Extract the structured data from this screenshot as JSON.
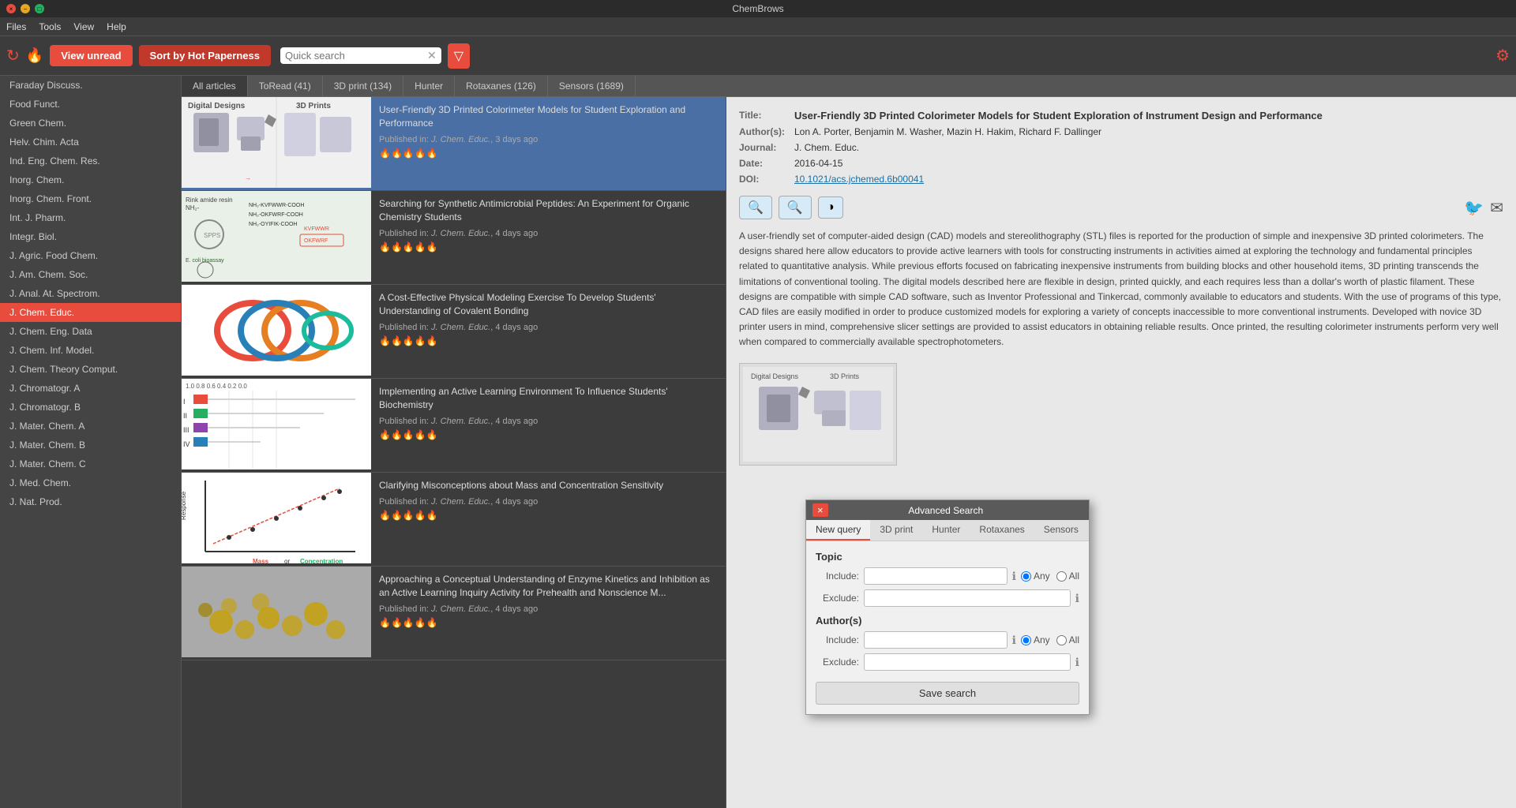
{
  "app": {
    "title": "ChemBrows"
  },
  "titlebar": {
    "close_btn": "×",
    "min_btn": "−",
    "max_btn": "□"
  },
  "menubar": {
    "items": [
      "Files",
      "Tools",
      "View",
      "Help"
    ]
  },
  "toolbar": {
    "view_unread_label": "View unread",
    "sort_label": "Sort by Hot Paperness",
    "search_placeholder": "Quick search",
    "settings_icon": "⚙"
  },
  "tabs": [
    {
      "label": "All articles",
      "active": false
    },
    {
      "label": "ToRead (41)",
      "active": false
    },
    {
      "label": "3D print (134)",
      "active": false
    },
    {
      "label": "Hunter",
      "active": false
    },
    {
      "label": "Rotaxanes (126)",
      "active": false
    },
    {
      "label": "Sensors (1689)",
      "active": false
    }
  ],
  "sidebar": {
    "items": [
      {
        "label": "Faraday Discuss.",
        "active": false
      },
      {
        "label": "Food Funct.",
        "active": false
      },
      {
        "label": "Green Chem.",
        "active": false
      },
      {
        "label": "Helv. Chim. Acta",
        "active": false
      },
      {
        "label": "Ind. Eng. Chem. Res.",
        "active": false
      },
      {
        "label": "Inorg. Chem.",
        "active": false
      },
      {
        "label": "Inorg. Chem. Front.",
        "active": false
      },
      {
        "label": "Int. J. Pharm.",
        "active": false
      },
      {
        "label": "Integr. Biol.",
        "active": false
      },
      {
        "label": "J. Agric. Food Chem.",
        "active": false
      },
      {
        "label": "J. Am. Chem. Soc.",
        "active": false
      },
      {
        "label": "J. Anal. At. Spectrom.",
        "active": false
      },
      {
        "label": "J. Chem. Educ.",
        "active": true
      },
      {
        "label": "J. Chem. Eng. Data",
        "active": false
      },
      {
        "label": "J. Chem. Inf. Model.",
        "active": false
      },
      {
        "label": "J. Chem. Theory Comput.",
        "active": false
      },
      {
        "label": "J. Chromatogr. A",
        "active": false
      },
      {
        "label": "J. Chromatogr. B",
        "active": false
      },
      {
        "label": "J. Mater. Chem. A",
        "active": false
      },
      {
        "label": "J. Mater. Chem. B",
        "active": false
      },
      {
        "label": "J. Mater. Chem. C",
        "active": false
      },
      {
        "label": "J. Med. Chem.",
        "active": false
      },
      {
        "label": "J. Nat. Prod.",
        "active": false
      }
    ]
  },
  "articles": [
    {
      "id": 1,
      "title": "User-Friendly 3D Printed Colorimeter Models for Student Exploration and Performance",
      "journal": "J. Chem. Educ.",
      "time": "3 days ago",
      "stars": "♥♥♥♥♥",
      "selected": true,
      "thumb_type": "3dprint"
    },
    {
      "id": 2,
      "title": "Searching for Synthetic Antimicrobial Peptides: An Experiment for Organic Chemistry Students",
      "journal": "J. Chem. Educ.",
      "time": "4 days ago",
      "stars": "♥♥♥♥♥",
      "selected": false,
      "thumb_type": "peptide"
    },
    {
      "id": 3,
      "title": "A Cost-Effective Physical Modeling Exercise To Develop Students' Understanding of Covalent Bonding",
      "journal": "J. Chem. Educ.",
      "time": "4 days ago",
      "stars": "♥♥♥♥♥",
      "selected": false,
      "thumb_type": "rings"
    },
    {
      "id": 4,
      "title": "Implementing an Active Learning Environment To Influence Students' Biochemistry",
      "journal": "J. Chem. Educ.",
      "time": "4 days ago",
      "stars": "♥♥♥♥♥",
      "selected": false,
      "thumb_type": "cluster"
    },
    {
      "id": 5,
      "title": "Clarifying Misconceptions about Mass and Concentration Sensitivity",
      "journal": "J. Chem. Educ.",
      "time": "4 days ago",
      "stars": "♥♥♥♥♥",
      "selected": false,
      "thumb_type": "graph"
    },
    {
      "id": 6,
      "title": "Approaching a Conceptual Understanding of Enzyme Kinetics and Inhibition as an Active Learning Inquiry Activity for Prehealth and Nonscience M...",
      "journal": "J. Chem. Educ.",
      "time": "4 days ago",
      "stars": "♥♥♥♥♥",
      "selected": false,
      "thumb_type": "coins"
    }
  ],
  "detail": {
    "title": "User-Friendly 3D Printed Colorimeter Models for Student Exploration of Instrument Design and Performance",
    "title_label": "Title:",
    "authors_label": "Author(s):",
    "authors": "Lon A. Porter, Benjamin M. Washer, Mazin H. Hakim, Richard F. Dallinger",
    "journal_label": "Journal:",
    "journal": "J. Chem. Educ.",
    "date_label": "Date:",
    "date": "2016-04-15",
    "doi_label": "DOI:",
    "doi": "10.1021/acs.jchemed.6b00041",
    "abstract": "A user-friendly set of computer-aided design (CAD) models and stereolithography (STL) files is reported for the production of simple and inexpensive 3D printed colorimeters. The designs shared here allow educators to provide active learners with tools for constructing instruments in activities aimed at exploring the technology and fundamental principles related to quantitative analysis. While previous efforts focused on fabricating inexpensive instruments from building blocks and other household items, 3D printing transcends the limitations of conventional tooling. The digital models described here are flexible in design, printed quickly, and each requires less than a dollar's worth of plastic filament. These designs are compatible with simple CAD software, such as Inventor Professional and Tinkercad, commonly available to educators and students. With the use of programs of this type, CAD files are easily modified in order to produce customized models for exploring a variety of concepts inaccessible to more conventional instruments. Developed with novice 3D printer users in mind, comprehensive slicer settings are provided to assist educators in obtaining reliable results. Once printed, the resulting colorimeter instruments perform very well when compared to commercially available spectrophotometers.",
    "search1_icon": "🔍",
    "search2_icon": "🔍",
    "contrast_icon": "◑"
  },
  "adv_search": {
    "title": "Advanced Search",
    "close_btn": "×",
    "tabs": [
      "New query",
      "3D print",
      "Hunter",
      "Rotaxanes",
      "Sensors"
    ],
    "topic_label": "Topic",
    "include_label": "Include:",
    "exclude_label": "Exclude:",
    "authors_label": "Author(s)",
    "include2_label": "Include:",
    "exclude2_label": "Exclude:",
    "any_label": "Any",
    "all_label": "All",
    "save_btn_label": "Save search"
  }
}
